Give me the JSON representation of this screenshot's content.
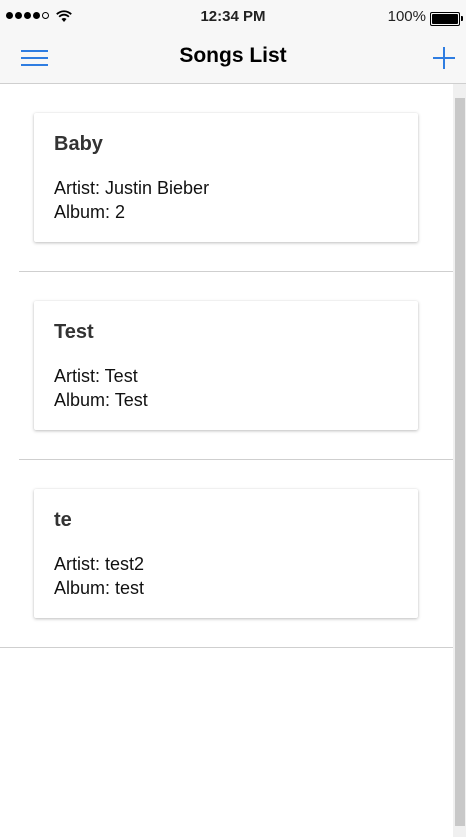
{
  "status_bar": {
    "time": "12:34 PM",
    "battery_percent": "100%",
    "signal_icon": "cellular-signal-icon",
    "wifi_icon": "wifi-icon",
    "battery_icon": "battery-icon"
  },
  "nav": {
    "title": "Songs List",
    "menu_icon": "hamburger-menu-icon",
    "add_icon": "plus-icon",
    "accent_color": "#2f7de1"
  },
  "songs": [
    {
      "title": "Baby",
      "artist": "Artist: Justin Bieber",
      "album": "Album: 2"
    },
    {
      "title": "Test",
      "artist": "Artist: Test",
      "album": "Album: Test"
    },
    {
      "title": "te",
      "artist": "Artist: test2",
      "album": "Album: test"
    }
  ]
}
